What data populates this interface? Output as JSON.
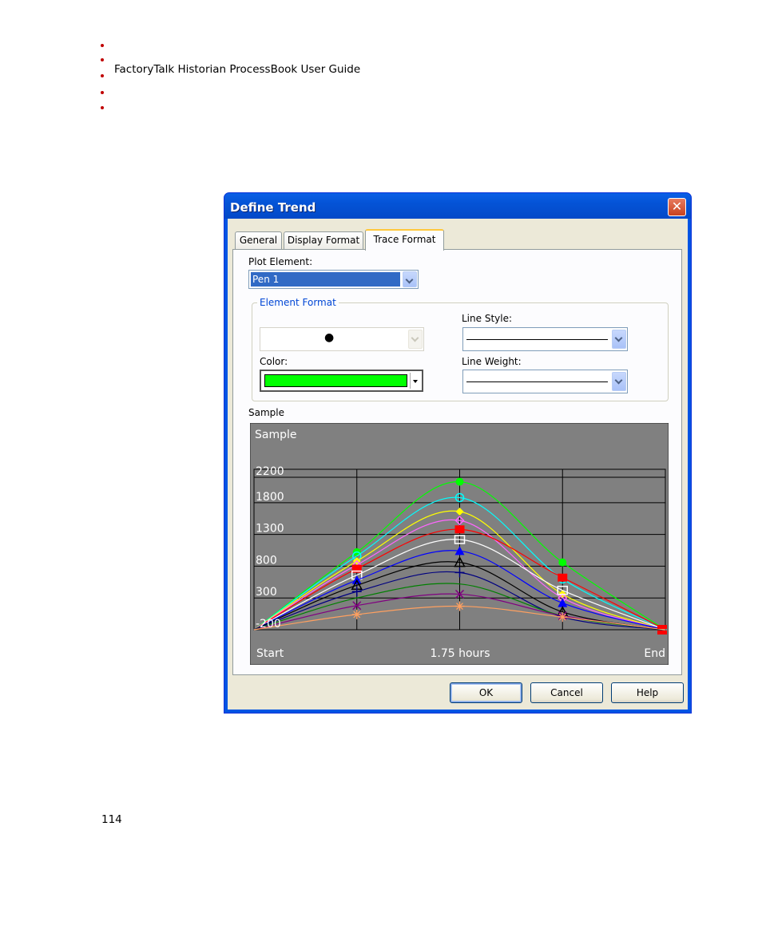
{
  "document": {
    "header": "FactoryTalk Historian ProcessBook User Guide",
    "page_number": "114"
  },
  "dialog": {
    "title": "Define Trend",
    "close_glyph": "✕",
    "tabs": [
      {
        "label": "General"
      },
      {
        "label": "Display Format"
      },
      {
        "label": "Trace Format"
      }
    ],
    "active_tab": "Trace Format",
    "plot_element_label": "Plot Element:",
    "plot_element_value": "Pen 1",
    "element_format_title": "Element Format",
    "marker_value": "●",
    "line_style_label": "Line Style:",
    "color_label": "Color:",
    "color_value": "#00ff00",
    "line_weight_label": "Line Weight:",
    "sample_label": "Sample",
    "buttons": {
      "ok": "OK",
      "cancel": "Cancel",
      "help": "Help"
    }
  },
  "chart_data": {
    "type": "line",
    "title": "Sample",
    "x_labels": {
      "start": "Start",
      "middle": "1.75 hours",
      "end": "End"
    },
    "y_ticks": [
      "2200",
      "1800",
      "1300",
      "800",
      "300",
      "-200"
    ],
    "ylim": [
      -200,
      2200
    ],
    "grid": true,
    "colors": {
      "plot_background": "#808080",
      "grid": "#000000",
      "text": "#ffffff"
    },
    "x": [
      0,
      0.25,
      0.5,
      0.75,
      1
    ],
    "series": [
      {
        "color": "#00ff00",
        "marker": "circle",
        "values": [
          -200,
          1020,
          2130,
          860,
          -200
        ]
      },
      {
        "color": "#00ffff",
        "marker": "open-circle",
        "values": [
          -200,
          960,
          1880,
          600,
          -200
        ]
      },
      {
        "color": "#ffff00",
        "marker": "diamond",
        "values": [
          -200,
          880,
          1660,
          360,
          -200
        ]
      },
      {
        "color": "#ff66ff",
        "marker": "open-diamond",
        "values": [
          -200,
          820,
          1520,
          300,
          -200
        ]
      },
      {
        "color": "#ff0000",
        "marker": "square",
        "values": [
          -200,
          760,
          1380,
          620,
          -200
        ]
      },
      {
        "color": "#ffffff",
        "marker": "open-square",
        "values": [
          -200,
          660,
          1220,
          420,
          -200
        ]
      },
      {
        "color": "#0000ff",
        "marker": "triangle",
        "values": [
          -200,
          580,
          1040,
          220,
          -200
        ]
      },
      {
        "color": "#000000",
        "marker": "open-triangle",
        "values": [
          -200,
          500,
          860,
          80,
          -200
        ]
      },
      {
        "color": "#000080",
        "marker": "plus",
        "values": [
          -200,
          400,
          700,
          0,
          -200
        ]
      },
      {
        "color": "#008000",
        "marker": "none",
        "values": [
          -200,
          300,
          520,
          20,
          -200
        ]
      },
      {
        "color": "#800080",
        "marker": "x",
        "values": [
          -200,
          180,
          360,
          20,
          -200
        ]
      },
      {
        "color": "#ffa060",
        "marker": "asterisk",
        "values": [
          -200,
          40,
          170,
          0,
          -200
        ]
      }
    ]
  }
}
